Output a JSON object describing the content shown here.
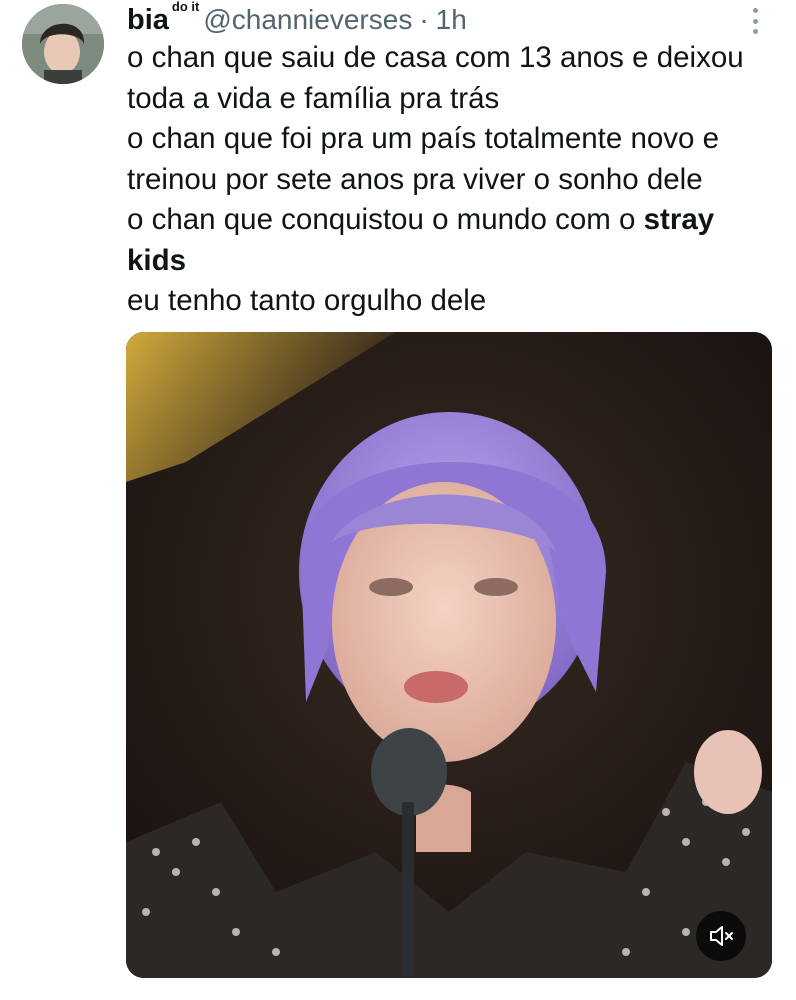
{
  "author": {
    "display_name": "bia",
    "name_superscript": "do it",
    "handle": "@channieverses",
    "separator": "·",
    "time": "1h",
    "avatar_icon": "profile-photo"
  },
  "tweet": {
    "lines": [
      "o chan que saiu de casa com 13 anos e deixou",
      "toda a vida e família pra trás",
      "o chan que foi pra um país totalmente novo e",
      "treinou por sete anos pra viver o sonho dele",
      "o chan que conquistou o mundo com o ",
      "kids",
      "eu tenho tanto orgulho dele"
    ],
    "bold_fragment": "stray"
  },
  "media": {
    "type": "video",
    "description_icon": "video-thumbnail",
    "mute_icon": "speaker-muted-icon"
  },
  "colors": {
    "text": "#0f1419",
    "secondary": "#536471",
    "hair": "#9b86d6"
  }
}
